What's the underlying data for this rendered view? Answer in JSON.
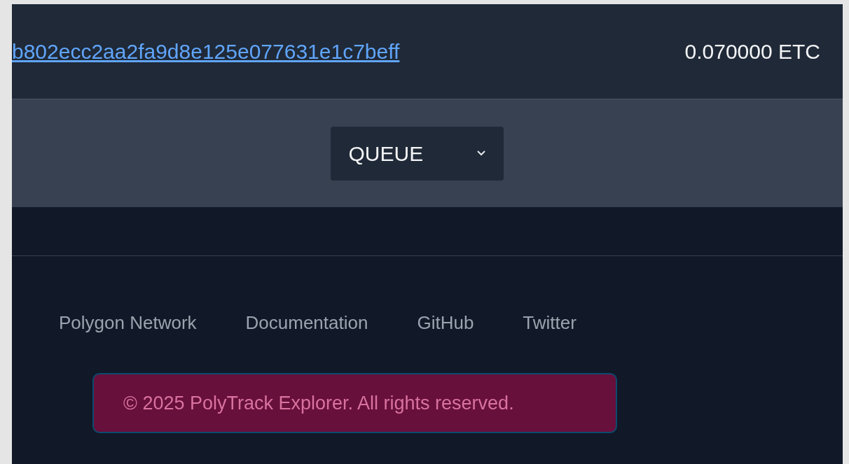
{
  "transaction": {
    "hash": "b802ecc2aa2fa9d8e125e077631e1c7beff",
    "amount": "0.070000 ETC"
  },
  "filter": {
    "value": "QUEUE"
  },
  "footer": {
    "links": [
      "Polygon Network",
      "Documentation",
      "GitHub",
      "Twitter"
    ],
    "copyright": "© 2025 PolyTrack Explorer. All rights reserved."
  }
}
